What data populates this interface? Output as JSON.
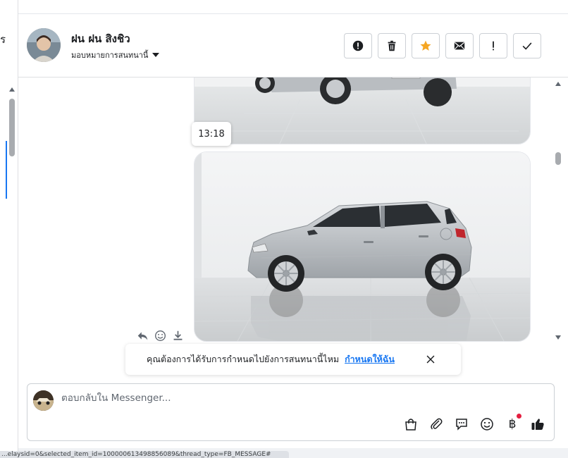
{
  "left_panel": {
    "letter": "ร"
  },
  "header": {
    "name": "ฝน ฝน สิงชิว",
    "assign_label": "มอบหมายการสนทนานี้",
    "actions": [
      {
        "icon": "alert-circle-icon"
      },
      {
        "icon": "trash-icon"
      },
      {
        "icon": "star-icon"
      },
      {
        "icon": "envelope-icon"
      },
      {
        "icon": "exclamation-icon"
      },
      {
        "icon": "check-icon"
      }
    ]
  },
  "chat": {
    "timestamp": "13:18"
  },
  "suggestion": {
    "text": "คุณต้องการได้รับการกำหนดไปยังการสนทนานี้ไหม",
    "link": "กำหนดให้ฉัน"
  },
  "composer": {
    "placeholder": "ตอบกลับใน Messenger..."
  },
  "status_bar": {
    "url": "...elaysid=0&selected_item_id=100000613498856089&thread_type=FB_MESSAGE#"
  },
  "colors": {
    "accent": "#1877f2",
    "star": "#f5a623",
    "notification": "#e41e3f"
  }
}
